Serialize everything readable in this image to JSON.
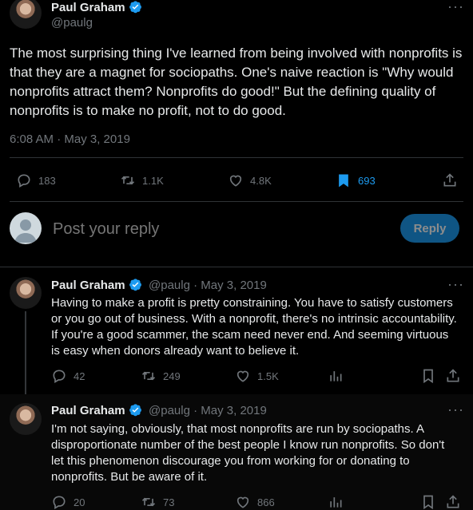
{
  "main_tweet": {
    "author": {
      "name": "Paul Graham",
      "handle": "@paulg"
    },
    "text": "The most surprising thing I've learned from being involved with nonprofits is that they are a magnet for sociopaths. One's naive reaction is \"Why would nonprofits attract them? Nonprofits do good!\" But the defining quality of nonprofits is to make no profit, not to do good.",
    "meta": "6:08 AM · May 3, 2019",
    "stats": {
      "replies": "183",
      "retweets": "1.1K",
      "likes": "4.8K",
      "bookmarks": "693"
    }
  },
  "composer": {
    "placeholder": "Post your reply",
    "button": "Reply"
  },
  "replies": [
    {
      "author": {
        "name": "Paul Graham",
        "meta": "@paulg · May 3, 2019"
      },
      "text": "Having to make a profit is pretty constraining. You have to satisfy customers or you go out of business. With a nonprofit, there's no intrinsic accountability. If you're a good scammer, the scam need never end. And seeming virtuous is easy when donors already want to believe it.",
      "stats": {
        "replies": "42",
        "retweets": "249",
        "likes": "1.5K"
      }
    },
    {
      "author": {
        "name": "Paul Graham",
        "meta": "@paulg · May 3, 2019"
      },
      "text": "I'm not saying, obviously, that most nonprofits are run by sociopaths. A disproportionate number of the best people I know run nonprofits. So don't let this phenomenon discourage you from working for or donating to nonprofits. But be aware of it.",
      "stats": {
        "replies": "20",
        "retweets": "73",
        "likes": "866"
      }
    }
  ],
  "colors": {
    "accent": "#1d9bf0",
    "muted": "#71767b",
    "text": "#e7e9ea",
    "background": "#000000",
    "divider": "#2f3336"
  }
}
